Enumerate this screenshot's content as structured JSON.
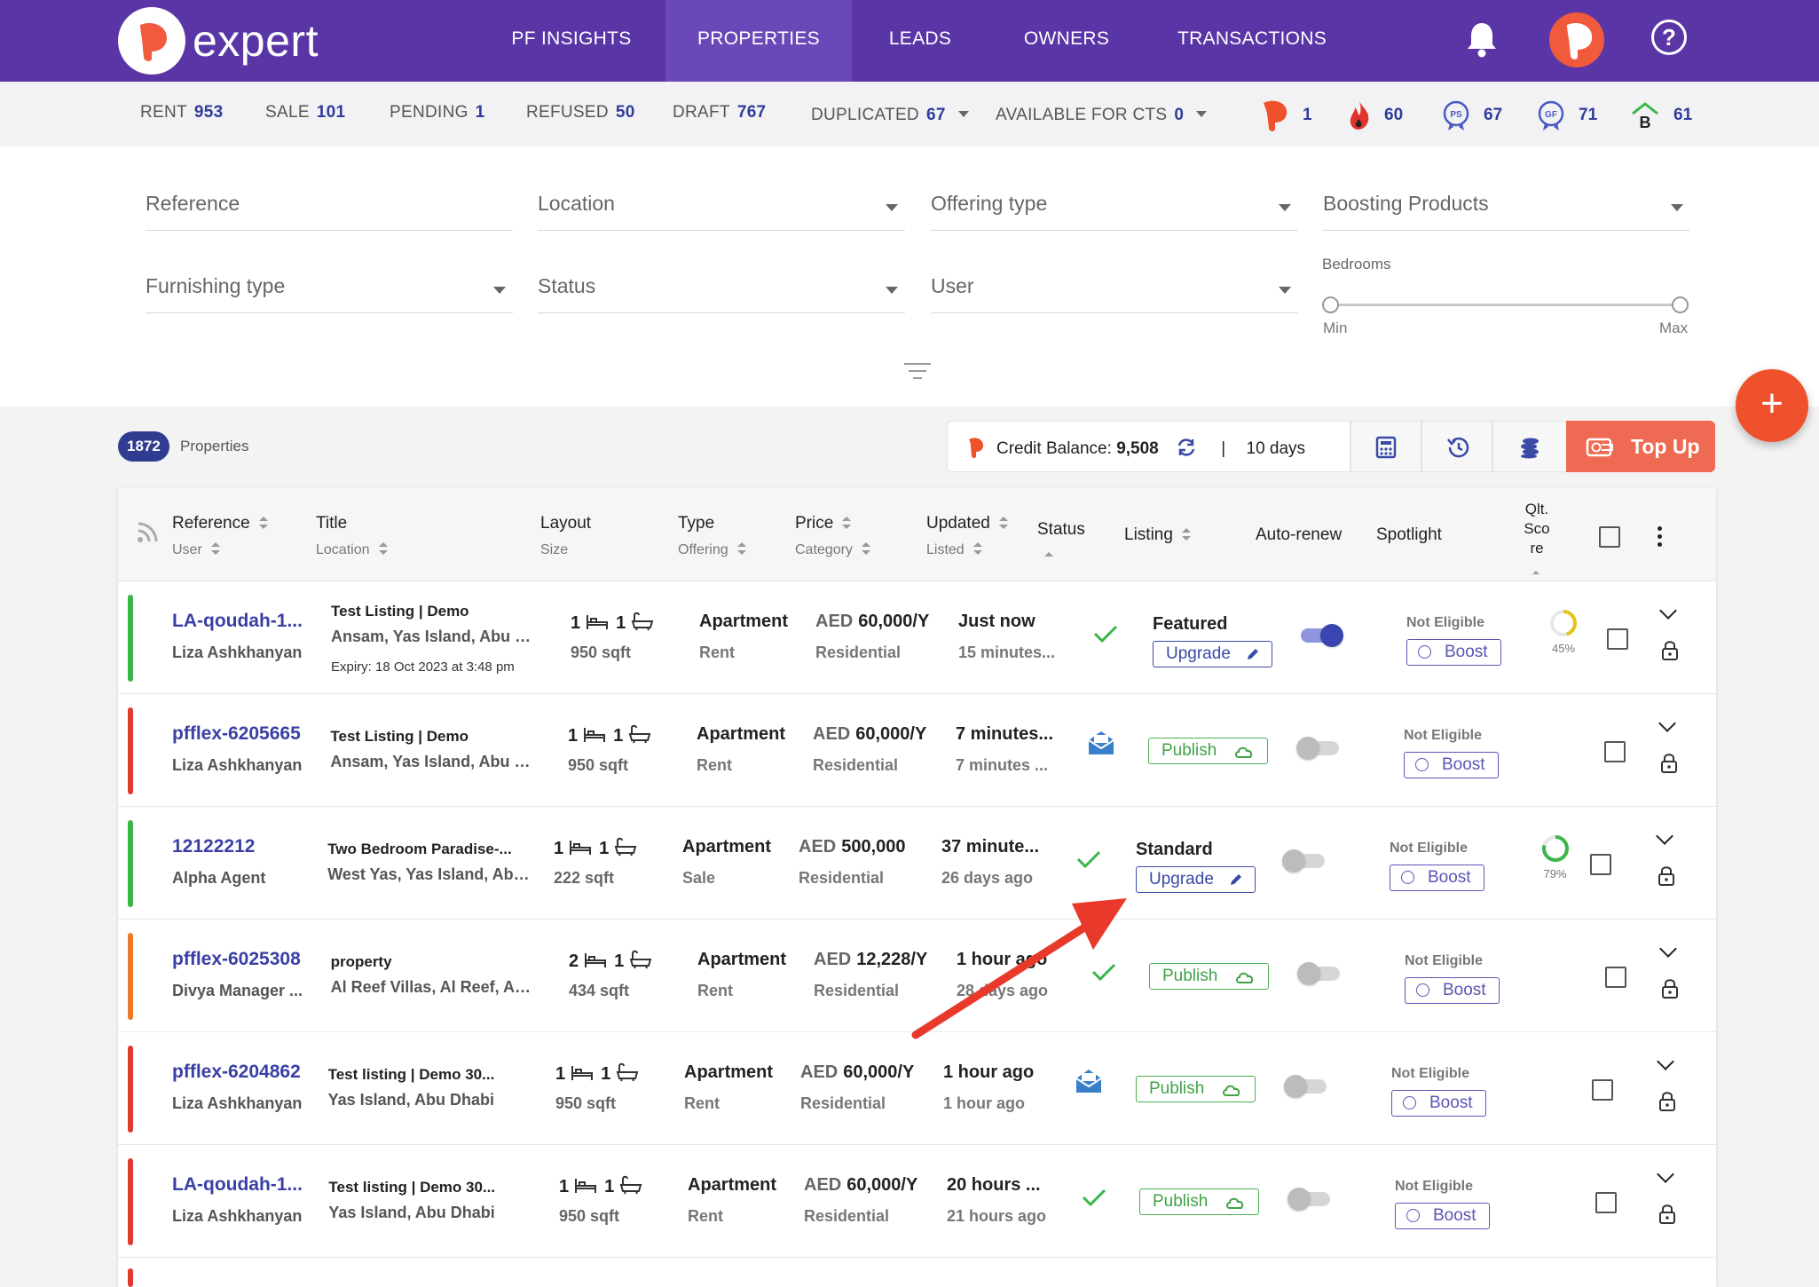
{
  "brand": {
    "logo_text": "expert"
  },
  "nav": {
    "items": [
      {
        "label": "PF INSIGHTS",
        "active": false
      },
      {
        "label": "PROPERTIES",
        "active": true
      },
      {
        "label": "LEADS",
        "active": false
      },
      {
        "label": "OWNERS",
        "active": false
      },
      {
        "label": "TRANSACTIONS",
        "active": false
      }
    ],
    "help_glyph": "?"
  },
  "stats": {
    "rent": {
      "label": "RENT",
      "value": "953"
    },
    "sale": {
      "label": "SALE",
      "value": "101"
    },
    "pending": {
      "label": "PENDING",
      "value": "1"
    },
    "refused": {
      "label": "REFUSED",
      "value": "50"
    },
    "draft": {
      "label": "DRAFT",
      "value": "767"
    },
    "duplicated": {
      "label": "DUPLICATED",
      "value": "67"
    },
    "available_cts": {
      "label": "AVAILABLE FOR CTS",
      "value": "0"
    },
    "badges": [
      {
        "icon": "pf-logo-icon",
        "value": "1"
      },
      {
        "icon": "flame-icon",
        "value": "60"
      },
      {
        "icon": "ps-badge-icon",
        "value": "67"
      },
      {
        "icon": "gf-badge-icon",
        "value": "71"
      },
      {
        "icon": "b-house-icon",
        "value": "61"
      }
    ]
  },
  "filters": {
    "reference": "Reference",
    "location": "Location",
    "offering_type": "Offering type",
    "boosting_products": "Boosting Products",
    "furnishing_type": "Furnishing type",
    "status": "Status",
    "user": "User",
    "bedrooms": {
      "label": "Bedrooms",
      "min_label": "Min",
      "max_label": "Max"
    }
  },
  "summary": {
    "count": "1872",
    "count_label": "Properties",
    "credit_label": "Credit Balance:",
    "credit_value": "9,508",
    "separator": "|",
    "days": "10 days",
    "topup_label": "Top Up",
    "fab_glyph": "+"
  },
  "table": {
    "headers": {
      "reference": "Reference",
      "user": "User",
      "title": "Title",
      "location": "Location",
      "layout": "Layout",
      "size": "Size",
      "type": "Type",
      "offering": "Offering",
      "price": "Price",
      "category": "Category",
      "updated": "Updated",
      "listed": "Listed",
      "status": "Status",
      "listing": "Listing",
      "auto_renew": "Auto-renew",
      "spotlight": "Spotlight",
      "qlt_score_1": "Qlt.",
      "qlt_score_2": "Sco",
      "qlt_score_3": "re"
    },
    "rows": [
      {
        "color": "#3cb54a",
        "ref": "LA-qoudah-1...",
        "user": "Liza Ashkhanyan",
        "title": "Test Listing | Demo",
        "location": "Ansam, Yas Island, Abu D...",
        "expiry": "Expiry: 18 Oct 2023 at 3:48 pm",
        "beds": "1",
        "baths": "1",
        "size": "950 sqft",
        "type": "Apartment",
        "offering": "Rent",
        "price_cur": "AED",
        "price_val": "60,000/Y",
        "category": "Residential",
        "updated": "Just now",
        "listed": "15 minutes...",
        "status": "check",
        "listing_title": "Featured",
        "listing_btn": "Upgrade",
        "listing_kind": "upgrade",
        "auto_renew": true,
        "spotlight": "Not Eligible",
        "boost": "Boost",
        "quality": 0.45,
        "quality_label": "45%"
      },
      {
        "color": "#e03a31",
        "ref": "pfflex-6205665",
        "user": "Liza Ashkhanyan",
        "title": "Test Listing | Demo",
        "location": "Ansam, Yas Island, Abu D...",
        "expiry": "",
        "beds": "1",
        "baths": "1",
        "size": "950 sqft",
        "type": "Apartment",
        "offering": "Rent",
        "price_cur": "AED",
        "price_val": "60,000/Y",
        "category": "Residential",
        "updated": "7 minutes...",
        "listed": "7 minutes ...",
        "status": "mail",
        "listing_title": "",
        "listing_btn": "Publish",
        "listing_kind": "publish",
        "auto_renew": false,
        "spotlight": "Not Eligible",
        "boost": "Boost",
        "quality": null,
        "quality_label": ""
      },
      {
        "color": "#3cb54a",
        "ref": "12122212",
        "user": "Alpha Agent",
        "title": "Two Bedroom Paradise-...",
        "location": "West Yas, Yas Island, Abu ...",
        "expiry": "",
        "beds": "1",
        "baths": "1",
        "size": "222 sqft",
        "type": "Apartment",
        "offering": "Sale",
        "price_cur": "AED",
        "price_val": "500,000",
        "category": "Residential",
        "updated": "37 minute...",
        "listed": "26 days ago",
        "status": "check",
        "listing_title": "Standard",
        "listing_btn": "Upgrade",
        "listing_kind": "upgrade",
        "auto_renew": false,
        "spotlight": "Not Eligible",
        "boost": "Boost",
        "quality": 0.79,
        "quality_label": "79%"
      },
      {
        "color": "#f07a2a",
        "ref": "pfflex-6025308",
        "user": "Divya Manager ...",
        "title": "property",
        "location": "Al Reef Villas, Al Reef, Ab...",
        "expiry": "",
        "beds": "2",
        "baths": "1",
        "size": "434 sqft",
        "type": "Apartment",
        "offering": "Rent",
        "price_cur": "AED",
        "price_val": "12,228/Y",
        "category": "Residential",
        "updated": "1 hour ago",
        "listed": "28 days ago",
        "status": "check",
        "listing_title": "",
        "listing_btn": "Publish",
        "listing_kind": "publish",
        "auto_renew": false,
        "spotlight": "Not Eligible",
        "boost": "Boost",
        "quality": null,
        "quality_label": ""
      },
      {
        "color": "#e03a31",
        "ref": "pfflex-6204862",
        "user": "Liza Ashkhanyan",
        "title": "Test listing | Demo 30...",
        "location": "Yas Island, Abu Dhabi",
        "expiry": "",
        "beds": "1",
        "baths": "1",
        "size": "950 sqft",
        "type": "Apartment",
        "offering": "Rent",
        "price_cur": "AED",
        "price_val": "60,000/Y",
        "category": "Residential",
        "updated": "1 hour ago",
        "listed": "1 hour ago",
        "status": "mail",
        "listing_title": "",
        "listing_btn": "Publish",
        "listing_kind": "publish",
        "auto_renew": false,
        "spotlight": "Not Eligible",
        "boost": "Boost",
        "quality": null,
        "quality_label": ""
      },
      {
        "color": "#e03a31",
        "ref": "LA-qoudah-1...",
        "user": "Liza Ashkhanyan",
        "title": "Test listing | Demo 30...",
        "location": "Yas Island, Abu Dhabi",
        "expiry": "",
        "beds": "1",
        "baths": "1",
        "size": "950 sqft",
        "type": "Apartment",
        "offering": "Rent",
        "price_cur": "AED",
        "price_val": "60,000/Y",
        "category": "Residential",
        "updated": "20 hours ...",
        "listed": "21 hours ago",
        "status": "check",
        "listing_title": "",
        "listing_btn": "Publish",
        "listing_kind": "publish",
        "auto_renew": false,
        "spotlight": "Not Eligible",
        "boost": "Boost",
        "quality": null,
        "quality_label": ""
      }
    ]
  },
  "colors": {
    "nav_bg": "#5a35a6",
    "accent": "#3a3fa5",
    "topup": "#ef6a52",
    "fab": "#f0512d",
    "arrow": "#e8392a"
  }
}
